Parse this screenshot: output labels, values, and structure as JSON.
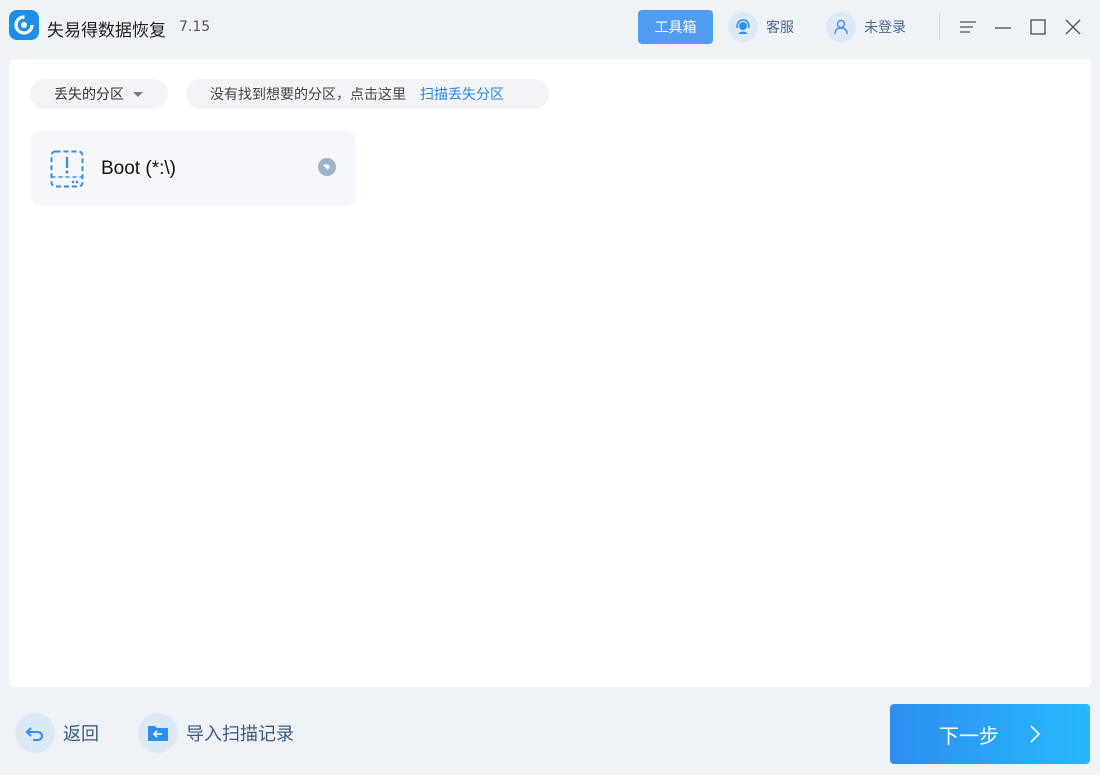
{
  "app": {
    "title": "失易得数据恢复",
    "version": "7.15"
  },
  "titlebar": {
    "toolbox_label": "工具箱",
    "service_label": "客服",
    "login_label": "未登录"
  },
  "filter": {
    "dropdown_value": "丢失的分区",
    "hint_text": "没有找到想要的分区，点击这里",
    "hint_link": "扫描丢失分区"
  },
  "partitions": [
    {
      "name": "Boot (*:\\)"
    }
  ],
  "footer": {
    "back_label": "返回",
    "import_label": "导入扫描记录",
    "next_label": "下一步"
  },
  "colors": {
    "accent": "#2e8ef0",
    "toolbox_bg": "#4f9cf0",
    "link": "#2a86e0"
  },
  "icons": {
    "logo": "app-logo-icon",
    "service": "headset-icon",
    "user": "user-icon",
    "menu": "menu-icon",
    "minimize": "minimize-icon",
    "maximize": "maximize-icon",
    "close": "close-icon",
    "partition": "lost-partition-icon",
    "radio": "radio-icon",
    "back": "back-arrow-icon",
    "import": "folder-import-icon",
    "next": "chevron-right-icon"
  }
}
